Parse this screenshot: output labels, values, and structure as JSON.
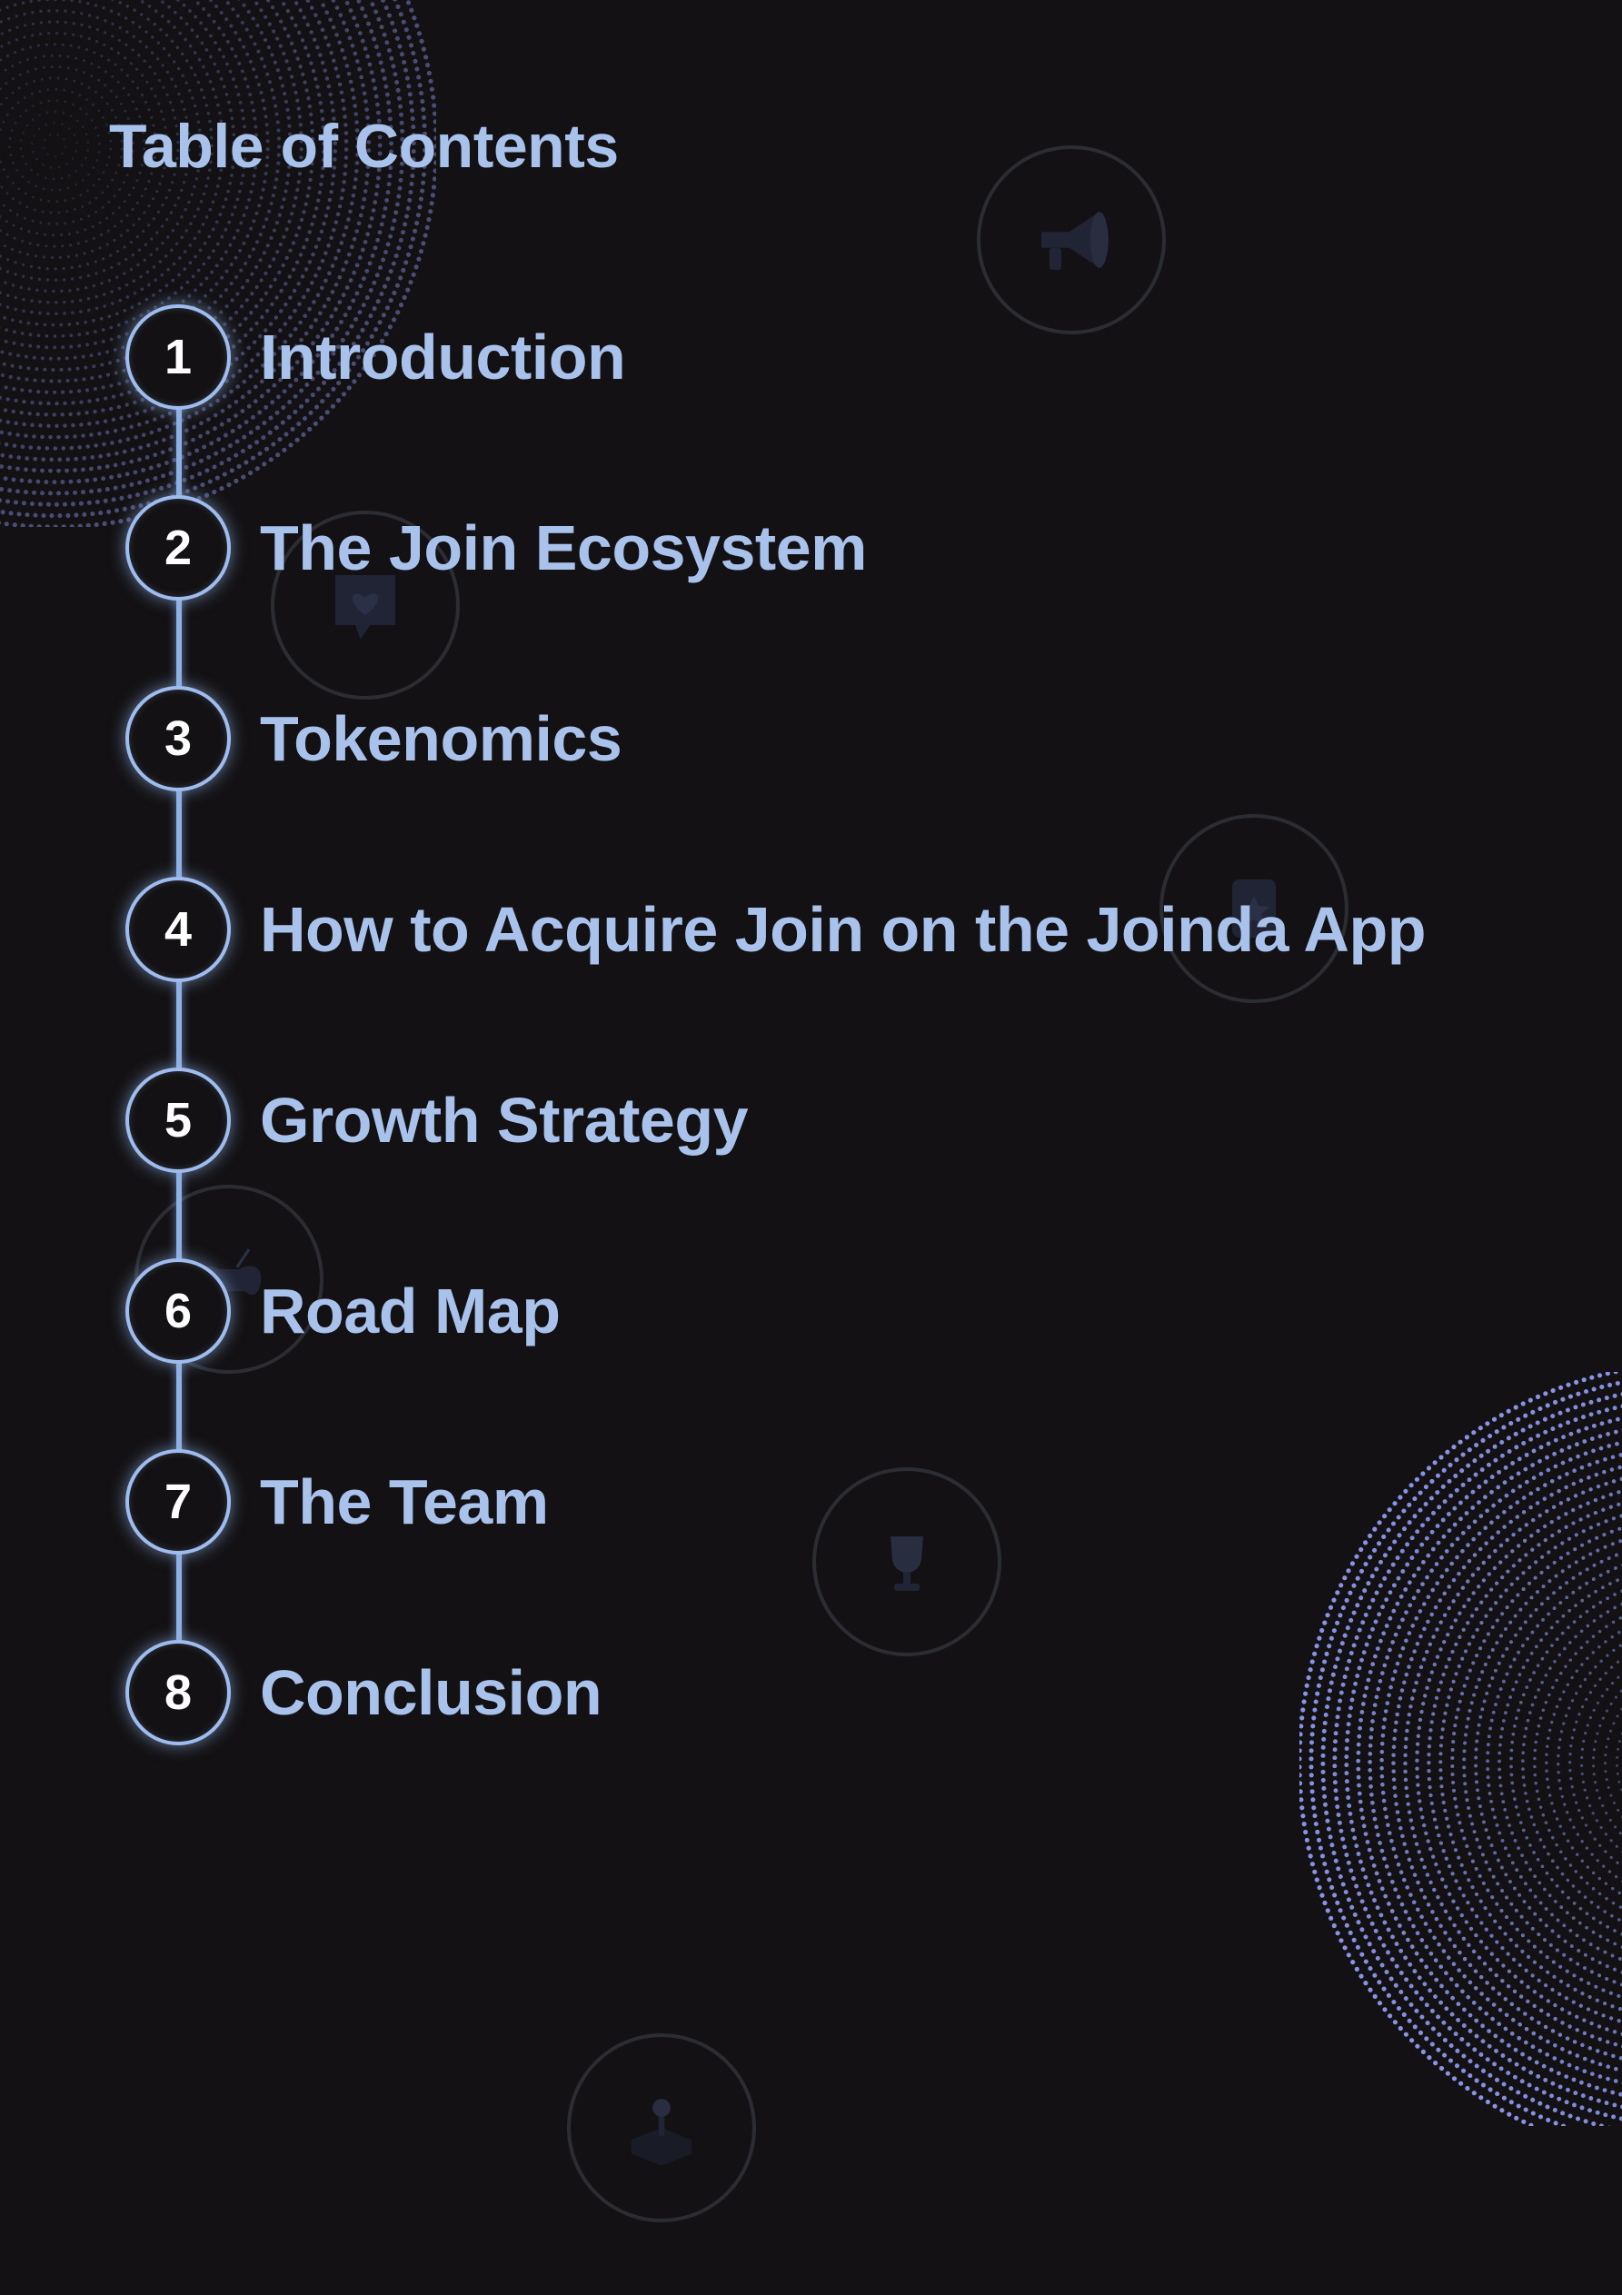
{
  "title": "Table of Contents",
  "toc": [
    {
      "number": "1",
      "label": "Introduction"
    },
    {
      "number": "2",
      "label": "The Join Ecosystem"
    },
    {
      "number": "3",
      "label": "Tokenomics"
    },
    {
      "number": "4",
      "label": "How to Acquire Join on the Joinda App"
    },
    {
      "number": "5",
      "label": "Growth Strategy"
    },
    {
      "number": "6",
      "label": "Road Map"
    },
    {
      "number": "7",
      "label": "The Team"
    },
    {
      "number": "8",
      "label": "Conclusion"
    }
  ],
  "decorations": [
    "megaphone-icon",
    "heart-chat-icon",
    "star-card-icon",
    "gamepad-icon",
    "trophy-icon",
    "joystick-icon"
  ],
  "colors": {
    "background": "#131113",
    "accent": "#a9c2ec",
    "ring": "#9fbcef",
    "sphere": "#8f9af0"
  }
}
